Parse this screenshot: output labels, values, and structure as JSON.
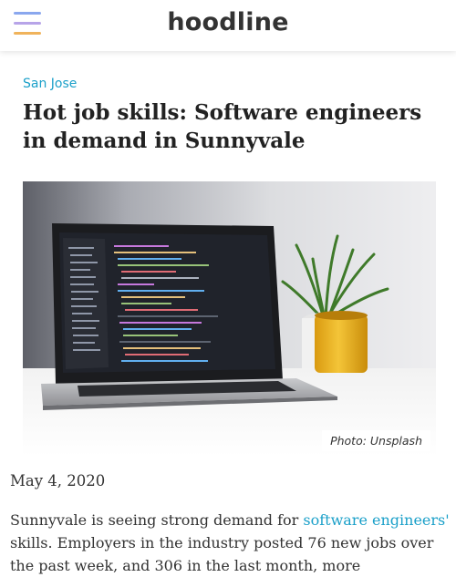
{
  "header": {
    "logo": "hoodline",
    "menu_icon": "hamburger-menu-icon"
  },
  "article": {
    "category": "San Jose",
    "headline": "Hot job skills: Software engineers in demand in Sunnyvale",
    "photo_credit": "Photo: Unsplash",
    "date": "May 4, 2020",
    "body": {
      "intro": "Sunnyvale is seeing strong demand for ",
      "link_text": "software engineers'",
      "rest": " skills. Employers in the industry posted 76 new jobs over the past week, and 306 in the last month, more"
    }
  },
  "colors": {
    "accent": "#1ba0c9",
    "menu_line_1": "#8aa7ee",
    "menu_line_2": "#b7a4e8",
    "menu_line_3": "#f0b35b"
  }
}
